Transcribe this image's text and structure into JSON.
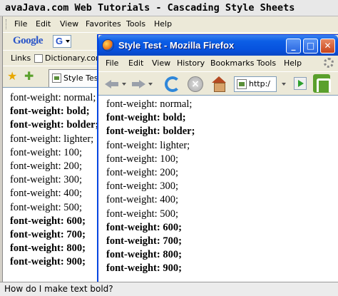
{
  "outer": {
    "title": "avaJava.com Web Tutorials - Cascading Style Sheets",
    "caption": "How do I make text bold?"
  },
  "ie": {
    "menu": [
      "File",
      "Edit",
      "View",
      "Favorites",
      "Tools",
      "Help"
    ],
    "google_logo": "Google",
    "google_box_letter": "G",
    "links_label": "Links",
    "links_item": "Dictionary.com",
    "tab_label": "Style Test",
    "lines": [
      "font-weight: normal;",
      "font-weight: bold;",
      "font-weight: bolder;",
      "font-weight: lighter;",
      "font-weight: 100;",
      "font-weight: 200;",
      "font-weight: 300;",
      "font-weight: 400;",
      "font-weight: 500;",
      "font-weight: 600;",
      "font-weight: 700;",
      "font-weight: 800;",
      "font-weight: 900;"
    ]
  },
  "ff": {
    "title": "Style Test - Mozilla Firefox",
    "menu": [
      "File",
      "Edit",
      "View",
      "History",
      "Bookmarks",
      "Tools",
      "Help"
    ],
    "url": "http:/",
    "lines": [
      "font-weight: normal;",
      "font-weight: bold;",
      "font-weight: bolder;",
      "font-weight: lighter;",
      "font-weight: 100;",
      "font-weight: 200;",
      "font-weight: 300;",
      "font-weight: 400;",
      "font-weight: 500;",
      "font-weight: 600;",
      "font-weight: 700;",
      "font-weight: 800;",
      "font-weight: 900;"
    ]
  },
  "icons": {
    "ie_favorites": "favorites-star-icon",
    "ie_add_favorites": "add-favorites-icon",
    "ff_minimize": "minimize-icon",
    "ff_maximize": "maximize-icon",
    "ff_close": "close-icon"
  }
}
